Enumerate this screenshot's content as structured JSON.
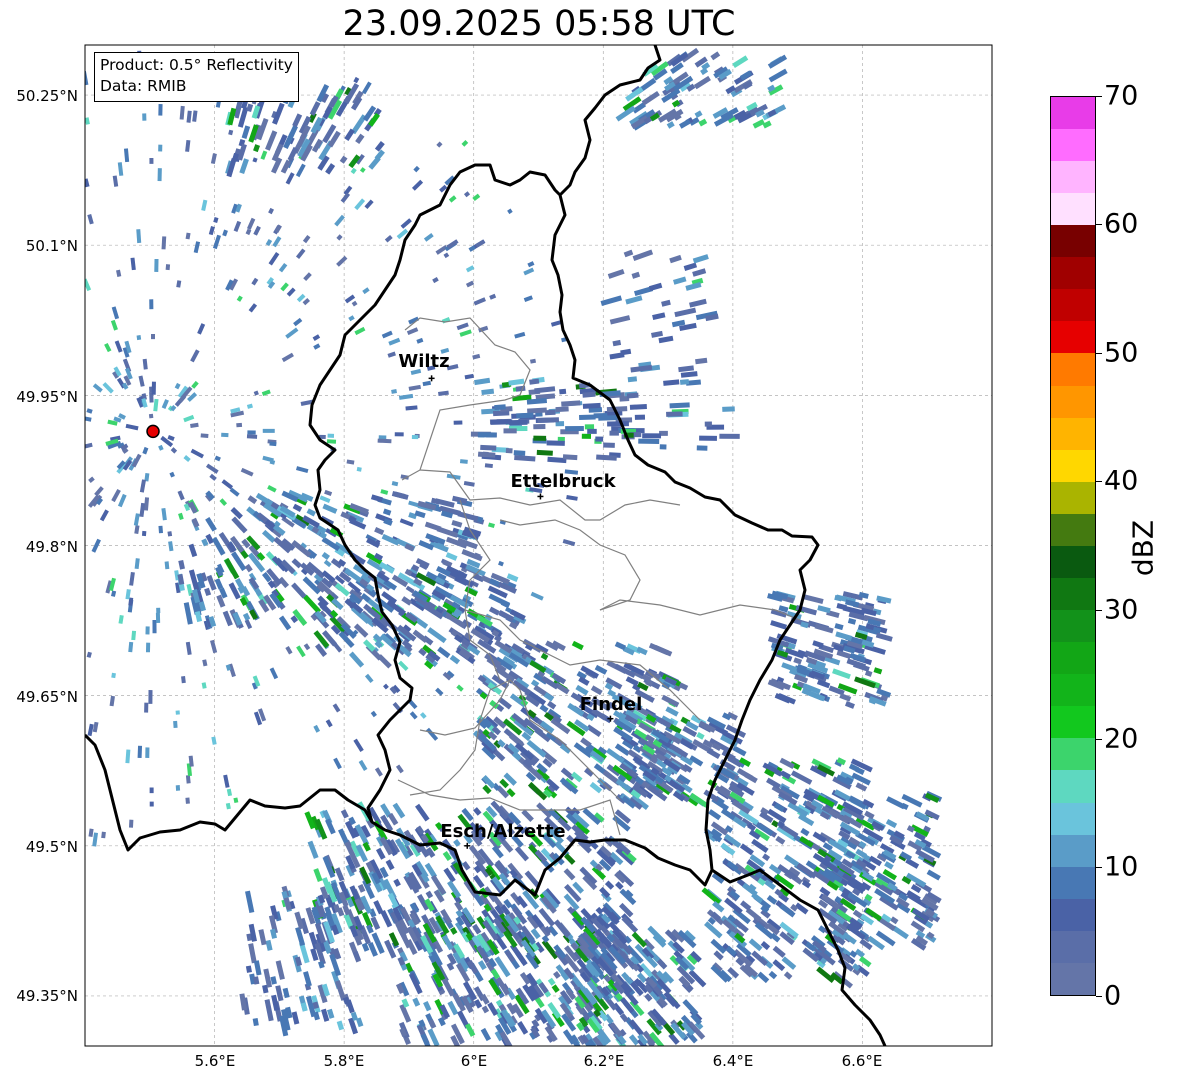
{
  "title": "23.09.2025 05:58 UTC",
  "infobox": {
    "product": "Product: 0.5° Reflectivity",
    "data_source": "Data: RMIB"
  },
  "axes": {
    "lat_ticks": [
      "50.25°N",
      "50.1°N",
      "49.95°N",
      "49.8°N",
      "49.65°N",
      "49.5°N",
      "49.35°N"
    ],
    "lon_ticks": [
      "5.6°E",
      "5.8°E",
      "6°E",
      "6.2°E",
      "6.4°E",
      "6.6°E"
    ]
  },
  "cities": [
    {
      "name": "Wiltz",
      "lon": 5.935,
      "lat": 49.967
    },
    {
      "name": "Ettelbruck",
      "lon": 6.103,
      "lat": 49.849
    },
    {
      "name": "Findel",
      "lon": 6.211,
      "lat": 49.627
    },
    {
      "name": "Esch/Alzette",
      "lon": 5.99,
      "lat": 49.5
    }
  ],
  "radar_site": {
    "lon": 5.505,
    "lat": 49.914,
    "color": "#e60000"
  },
  "colorbar": {
    "label": "dBZ",
    "min": 0,
    "max": 70,
    "tick_labels": [
      "0",
      "10",
      "20",
      "30",
      "40",
      "50",
      "60",
      "70"
    ],
    "colors": [
      "#6475a8",
      "#5a6ea8",
      "#4a62a6",
      "#4878b4",
      "#5a9cc8",
      "#6ac4dc",
      "#5ed8c0",
      "#3cd46c",
      "#12c81e",
      "#12b41a",
      "#12a616",
      "#12921a",
      "#107812",
      "#0a5a10",
      "#447a10",
      "#aab400",
      "#ffd700",
      "#ffb400",
      "#ff9600",
      "#ff7a00",
      "#e60000",
      "#c00000",
      "#a00000",
      "#780000",
      "#ffe0ff",
      "#ffb4ff",
      "#ff6cff",
      "#e83ce8"
    ]
  },
  "map": {
    "lon_range": [
      5.4,
      6.8
    ],
    "lat_range": [
      49.3,
      50.3
    ],
    "grid": true,
    "colors": {
      "border": "#000000",
      "canton": "#808080",
      "grid": "#b0b0b0",
      "echo_base": "#4a62a6"
    }
  }
}
